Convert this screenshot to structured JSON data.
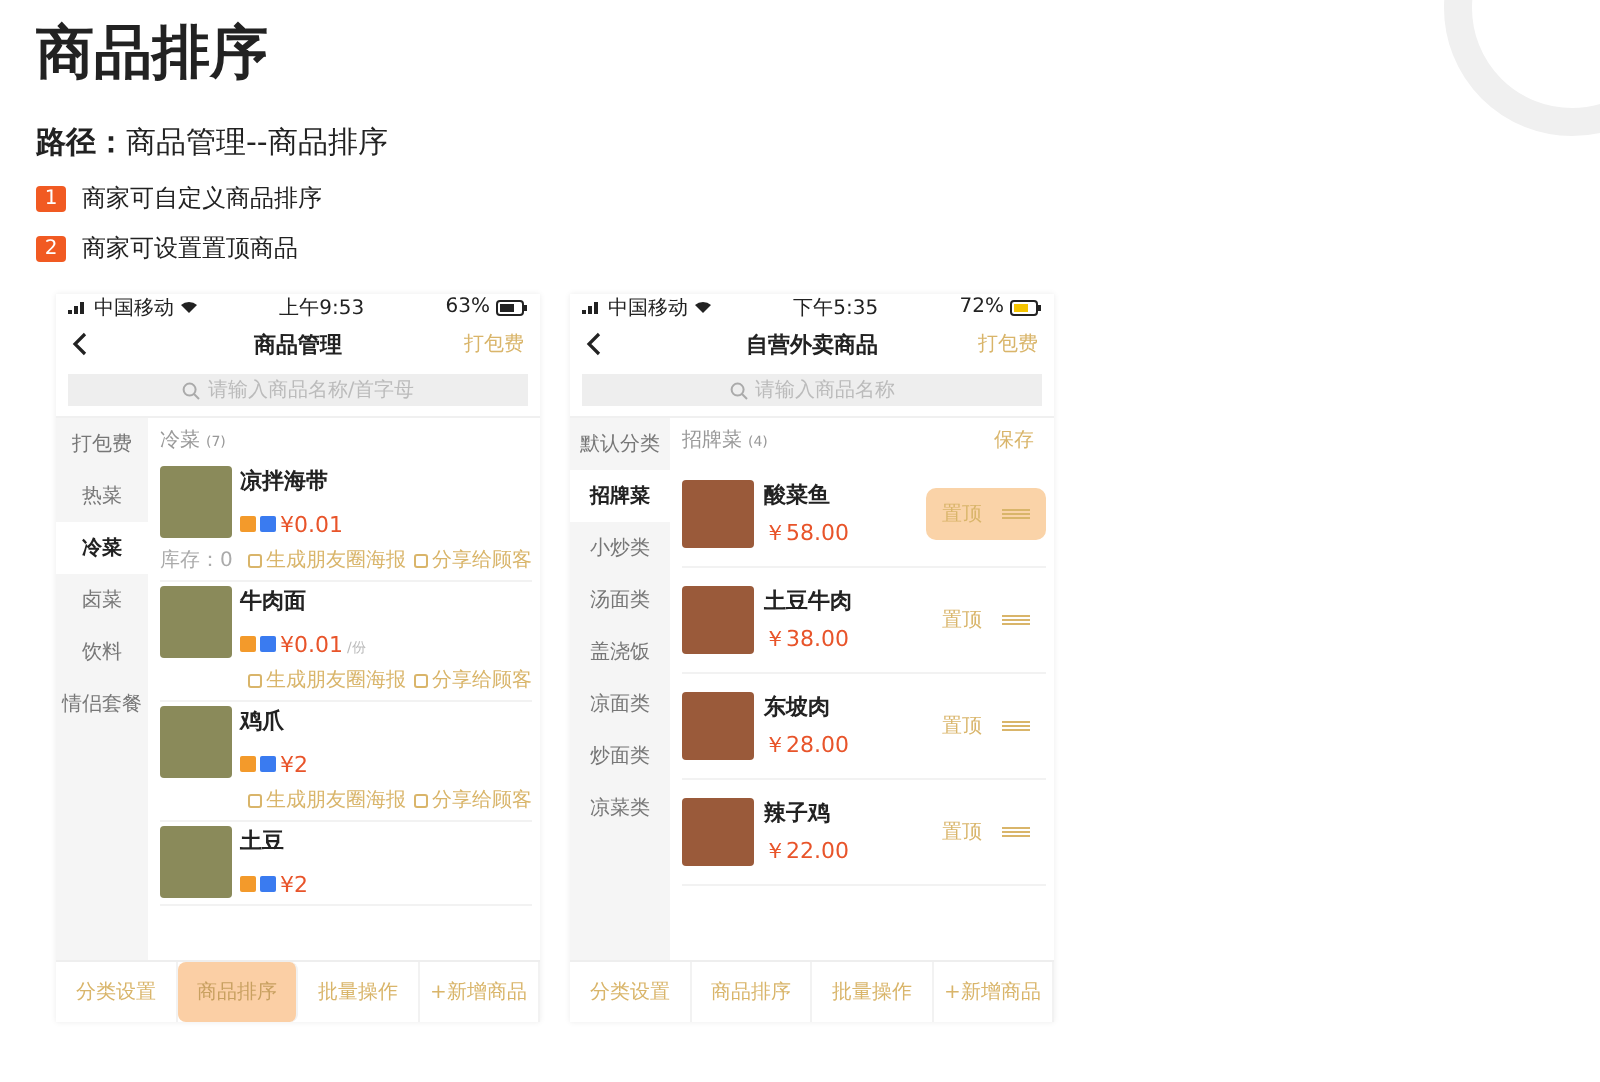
{
  "title": "商品排序",
  "path": {
    "label": "路径：",
    "value": "商品管理--商品排序"
  },
  "notes": [
    {
      "number": "1",
      "text": "商家可自定义商品排序"
    },
    {
      "number": "2",
      "text": "商家可设置置顶商品"
    }
  ],
  "phones": [
    {
      "kind": "manage",
      "status": {
        "carrier": "中国移动",
        "time": "上午9:53",
        "battery": "63%",
        "charging": false
      },
      "nav": {
        "title": "商品管理",
        "action": "打包费"
      },
      "search": {
        "placeholder": "请输入商品名称/首字母"
      },
      "sidebar": [
        {
          "label": "打包费",
          "selected": false
        },
        {
          "label": "热菜",
          "selected": false
        },
        {
          "label": "冷菜",
          "selected": true
        },
        {
          "label": "卤菜",
          "selected": false
        },
        {
          "label": "饮料",
          "selected": false
        },
        {
          "label": "情侣套餐",
          "selected": false
        }
      ],
      "section": {
        "title": "冷菜",
        "count": "(7)"
      },
      "products": [
        {
          "name": "凉拌海带",
          "price": "¥0.01",
          "stock": "库存：0",
          "actions": [
            "生成朋友圈海报",
            "分享给顾客"
          ]
        },
        {
          "name": "牛肉面",
          "price": "¥0.01",
          "unit": "/份",
          "actions": [
            "生成朋友圈海报",
            "分享给顾客"
          ]
        },
        {
          "name": "鸡爪",
          "price": "¥2",
          "actions": [
            "生成朋友圈海报",
            "分享给顾客"
          ]
        },
        {
          "name": "土豆",
          "price": "¥2"
        }
      ],
      "tabs": [
        {
          "label": "分类设置",
          "selected": false
        },
        {
          "label": "商品排序",
          "selected": true
        },
        {
          "label": "批量操作",
          "selected": false
        },
        {
          "label": "+新增商品",
          "selected": false
        }
      ]
    },
    {
      "kind": "sort",
      "status": {
        "carrier": "中国移动",
        "time": "下午5:35",
        "battery": "72%",
        "charging": true
      },
      "nav": {
        "title": "自营外卖商品",
        "action": "打包费"
      },
      "search": {
        "placeholder": "请输入商品名称"
      },
      "sidebar": [
        {
          "label": "默认分类",
          "selected": false
        },
        {
          "label": "招牌菜",
          "selected": true
        },
        {
          "label": "小炒类",
          "selected": false
        },
        {
          "label": "汤面类",
          "selected": false
        },
        {
          "label": "盖浇饭",
          "selected": false
        },
        {
          "label": "凉面类",
          "selected": false
        },
        {
          "label": "炒面类",
          "selected": false
        },
        {
          "label": "凉菜类",
          "selected": false
        }
      ],
      "section": {
        "title": "招牌菜",
        "count": "(4)",
        "save": "保存"
      },
      "products": [
        {
          "name": "酸菜鱼",
          "price": "￥58.00",
          "pin": "置顶",
          "selected": true
        },
        {
          "name": "土豆牛肉",
          "price": "￥38.00",
          "pin": "置顶",
          "selected": false
        },
        {
          "name": "东坡肉",
          "price": "￥28.00",
          "pin": "置顶",
          "selected": false
        },
        {
          "name": "辣子鸡",
          "price": "￥22.00",
          "pin": "置顶",
          "selected": false
        }
      ],
      "tabs": [
        {
          "label": "分类设置",
          "selected": false
        },
        {
          "label": "商品排序",
          "selected": false
        },
        {
          "label": "批量操作",
          "selected": false
        },
        {
          "label": "+新增商品",
          "selected": false
        }
      ]
    }
  ]
}
